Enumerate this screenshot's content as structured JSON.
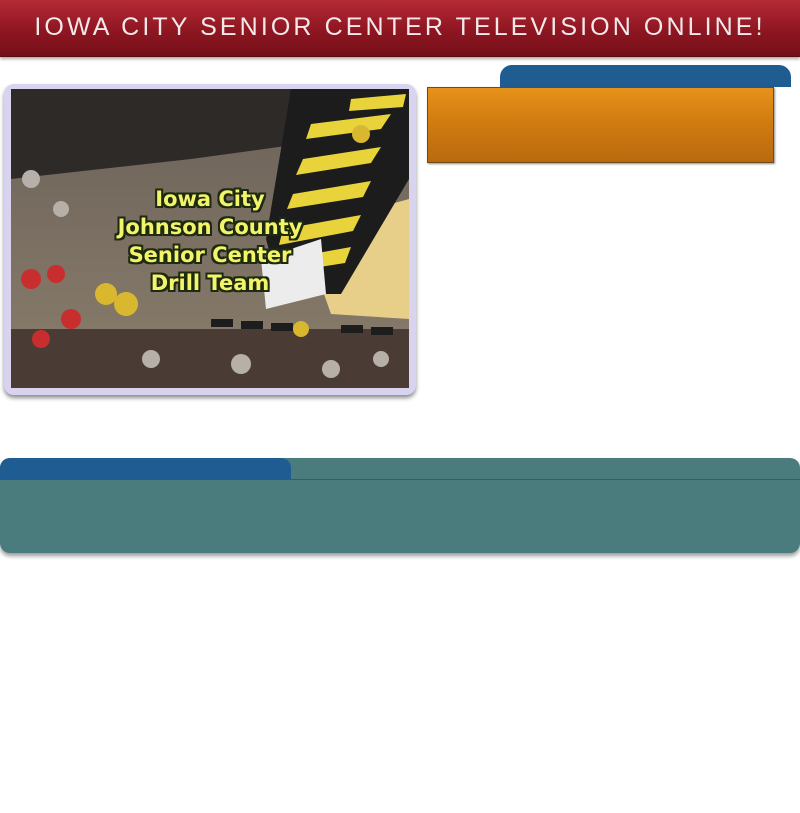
{
  "header": {
    "title": "IOWA CITY SENIOR CENTER TELEVISION ONLINE!"
  },
  "video": {
    "caption_lines": [
      "Iowa City",
      "Johnson County",
      "Senior Center",
      "Drill Team"
    ]
  },
  "colors": {
    "header": "#8e1621",
    "tab": "#1f5c92",
    "orange_box": "#d17c10",
    "teal_panel": "#4a7c7d"
  }
}
